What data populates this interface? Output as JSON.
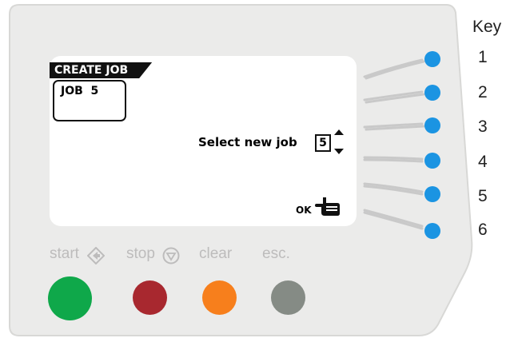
{
  "screen": {
    "tab_title": "CREATE JOB",
    "job_label": "JOB  5",
    "select_label": "Select new job",
    "select_value": "5",
    "ok_label": "OK"
  },
  "buttons": [
    {
      "label": "start",
      "icon": "diamond-arrow-icon",
      "color": "#0fa84a"
    },
    {
      "label": "stop",
      "icon": "stop-triangle-icon",
      "color": "#a8282f"
    },
    {
      "label": "clear",
      "icon": "",
      "color": "#f77f1c"
    },
    {
      "label": "esc.",
      "icon": "",
      "color": "#858b85"
    }
  ],
  "soft_keys_color": "#1b94e2",
  "key": {
    "title": "Key",
    "numbers": [
      "1",
      "2",
      "3",
      "4",
      "5",
      "6"
    ]
  },
  "colors": {
    "panel": "#ebebea",
    "panel_border": "#d8d8d6",
    "lines": "#c9c9c9"
  }
}
